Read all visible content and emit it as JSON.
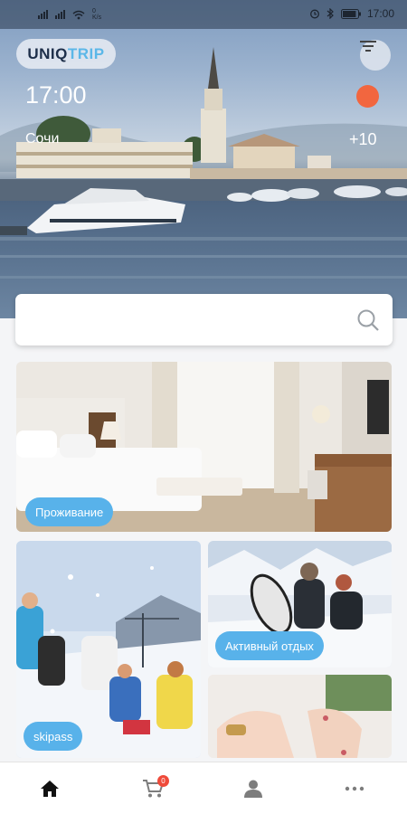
{
  "status_bar": {
    "net_speed": "0 K/s",
    "time": "17:00",
    "battery_level": 0.9
  },
  "header": {
    "logo_part1": "UNIQ",
    "logo_part2": "TRIP",
    "time": "17:00",
    "city": "Сочи",
    "temperature": "+10",
    "filter_icon": "filter-icon",
    "weather_icon": "sun-icon"
  },
  "search": {
    "value": "",
    "placeholder": "",
    "icon": "search-icon"
  },
  "categories": [
    {
      "label": "Проживание",
      "image": "hotel-room"
    },
    {
      "label": "skipass",
      "image": "ski-resort"
    },
    {
      "label": "Активный отдых",
      "image": "snowboarders"
    },
    {
      "label": "",
      "image": "spa-manicure"
    }
  ],
  "bottom_nav": {
    "items": [
      {
        "name": "home",
        "icon": "home-icon",
        "active": true
      },
      {
        "name": "cart",
        "icon": "cart-icon",
        "active": false
      },
      {
        "name": "profile",
        "icon": "user-icon",
        "active": false
      },
      {
        "name": "more",
        "icon": "more-icon",
        "active": false
      }
    ],
    "cart_count": "0"
  },
  "colors": {
    "accent": "#58b2ea",
    "logo_dark": "#1e2f4a",
    "logo_light": "#5bb7e8",
    "weather": "#f2663f",
    "badge": "#ef4a3a"
  }
}
